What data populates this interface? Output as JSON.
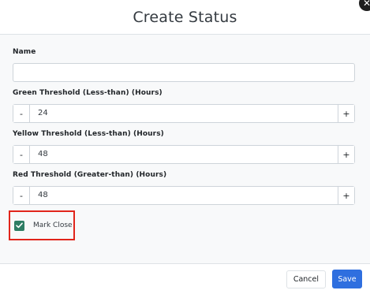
{
  "dialog": {
    "title": "Create Status",
    "close_icon": "close-icon"
  },
  "form": {
    "name": {
      "label": "Name",
      "value": "",
      "placeholder": ""
    },
    "green_threshold": {
      "label": "Green Threshold (Less-than) (Hours)",
      "value": "24",
      "minus": "-",
      "plus": "+"
    },
    "yellow_threshold": {
      "label": "Yellow Threshold (Less-than) (Hours)",
      "value": "48",
      "minus": "-",
      "plus": "+"
    },
    "red_threshold": {
      "label": "Red Threshold (Greater-than) (Hours)",
      "value": "48",
      "minus": "-",
      "plus": "+"
    },
    "mark_close": {
      "label": "Mark Close",
      "checked": true
    }
  },
  "footer": {
    "cancel_label": "Cancel",
    "save_label": "Save"
  },
  "colors": {
    "primary": "#2f6fdf",
    "checkbox": "#2e7d64",
    "highlight": "#e1251b"
  }
}
